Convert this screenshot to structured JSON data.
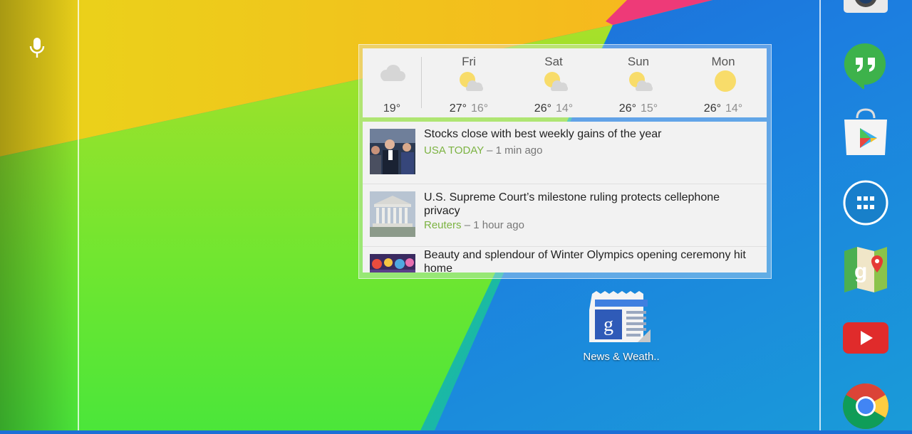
{
  "weather": {
    "current": {
      "temp": "19°",
      "icon": "cloudy-icon"
    },
    "forecast": [
      {
        "day": "Fri",
        "high": "27°",
        "low": "16°",
        "icon": "partly-cloudy-icon"
      },
      {
        "day": "Sat",
        "high": "26°",
        "low": "14°",
        "icon": "partly-cloudy-icon"
      },
      {
        "day": "Sun",
        "high": "26°",
        "low": "15°",
        "icon": "partly-cloudy-icon"
      },
      {
        "day": "Mon",
        "high": "26°",
        "low": "14°",
        "icon": "sunny-icon"
      }
    ]
  },
  "news": [
    {
      "title": "Stocks close with best weekly gains of the year",
      "source": "USA TODAY",
      "time": "– 1 min ago"
    },
    {
      "title": "U.S. Supreme Court’s milestone ruling protects cellephone privacy",
      "source": "Reuters",
      "time": "– 1 hour ago"
    },
    {
      "title": "Beauty and splendour of Winter Olympics opening ceremony hit home",
      "source": "",
      "time": ""
    }
  ],
  "desktop": {
    "news_weather_label": "News & Weath.."
  },
  "dock": [
    "camera-icon",
    "hangouts-icon",
    "play-store-icon",
    "app-drawer-icon",
    "maps-icon",
    "youtube-icon",
    "chrome-icon"
  ],
  "colors": {
    "source_green": "#7cb342",
    "wallpaper_blue": "#1c6fd6",
    "wallpaper_green": "#4fe33a",
    "wallpaper_yellow": "#f2dc1a"
  }
}
